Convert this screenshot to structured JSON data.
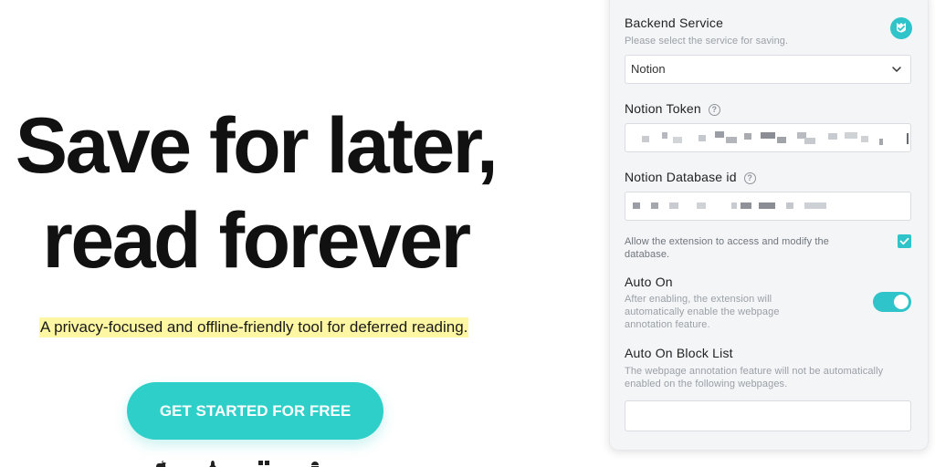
{
  "hero": {
    "title_line_1": "Save for later,",
    "title_line_2": "read forever",
    "tagline": "A privacy-focused and offline-friendly tool for deferred reading.",
    "cta_label": "GET STARTED FOR FREE",
    "platform_icons": [
      "apple-icon",
      "linux-icon",
      "windows-icon",
      "android-icon"
    ]
  },
  "settings": {
    "backend": {
      "label": "Backend Service",
      "description": "Please select the service for saving.",
      "selected": "Notion"
    },
    "notion_token": {
      "label": "Notion Token",
      "value_obscured": true
    },
    "notion_database": {
      "label": "Notion Database id",
      "value_obscured": true
    },
    "allow_access": {
      "label": "Allow the extension to access and modify the database.",
      "checked": true
    },
    "auto_on": {
      "label": "Auto On",
      "description": "After enabling, the extension will automatically enable the webpage annotation feature.",
      "enabled": true
    },
    "auto_on_block_list": {
      "label": "Auto On Block List",
      "description": "The webpage annotation feature will not be automatically enabled on the following webpages.",
      "value": ""
    }
  },
  "colors": {
    "accent": "#2ec4c9",
    "cta": "#2ecfc8",
    "highlight": "#fdf6a3",
    "panel_bg": "#f4f5f7"
  }
}
